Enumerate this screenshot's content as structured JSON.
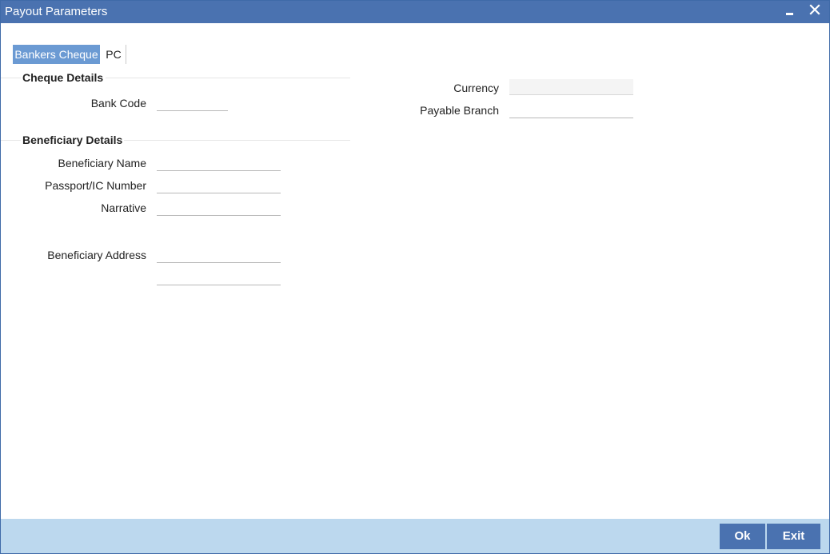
{
  "window": {
    "title": "Payout Parameters",
    "minimize_icon": "minimize-icon",
    "close_icon": "close-icon"
  },
  "tabs": [
    {
      "label": "Bankers Cheque",
      "active": true
    },
    {
      "label": "PC",
      "active": false
    }
  ],
  "cheque_details": {
    "title": "Cheque Details",
    "bank_code": {
      "label": "Bank Code",
      "value": ""
    },
    "currency": {
      "label": "Currency",
      "value": ""
    },
    "payable_branch": {
      "label": "Payable Branch",
      "value": ""
    }
  },
  "beneficiary_details": {
    "title": "Beneficiary Details",
    "name": {
      "label": "Beneficiary Name",
      "value": ""
    },
    "passport": {
      "label": "Passport/IC Number",
      "value": ""
    },
    "narrative": {
      "label": "Narrative",
      "value": ""
    },
    "address": {
      "label": "Beneficiary Address",
      "line1": "",
      "line2": ""
    }
  },
  "footer": {
    "ok_label": "Ok",
    "exit_label": "Exit"
  },
  "colors": {
    "titlebar": "#4a72b0",
    "active_tab": "#6b9ad3",
    "footer": "#bcd8ee",
    "button": "#4a72b0"
  }
}
